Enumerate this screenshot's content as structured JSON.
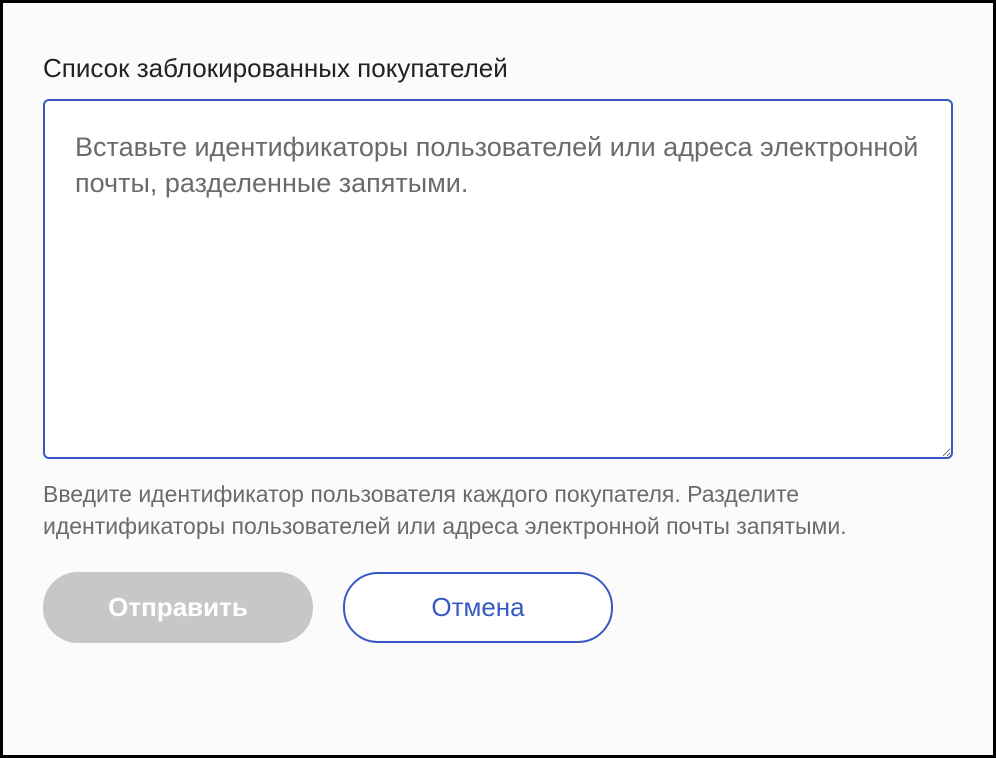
{
  "form": {
    "label": "Список заблокированных покупателей",
    "textarea": {
      "placeholder": "Вставьте идентификаторы пользователей или адреса электронной почты, разделенные запятыми.",
      "value": ""
    },
    "helpText": "Введите идентификатор пользователя каждого покупателя. Разделите идентификаторы пользователей или адреса электронной почты запятыми.",
    "buttons": {
      "submit": "Отправить",
      "cancel": "Отмена"
    }
  }
}
